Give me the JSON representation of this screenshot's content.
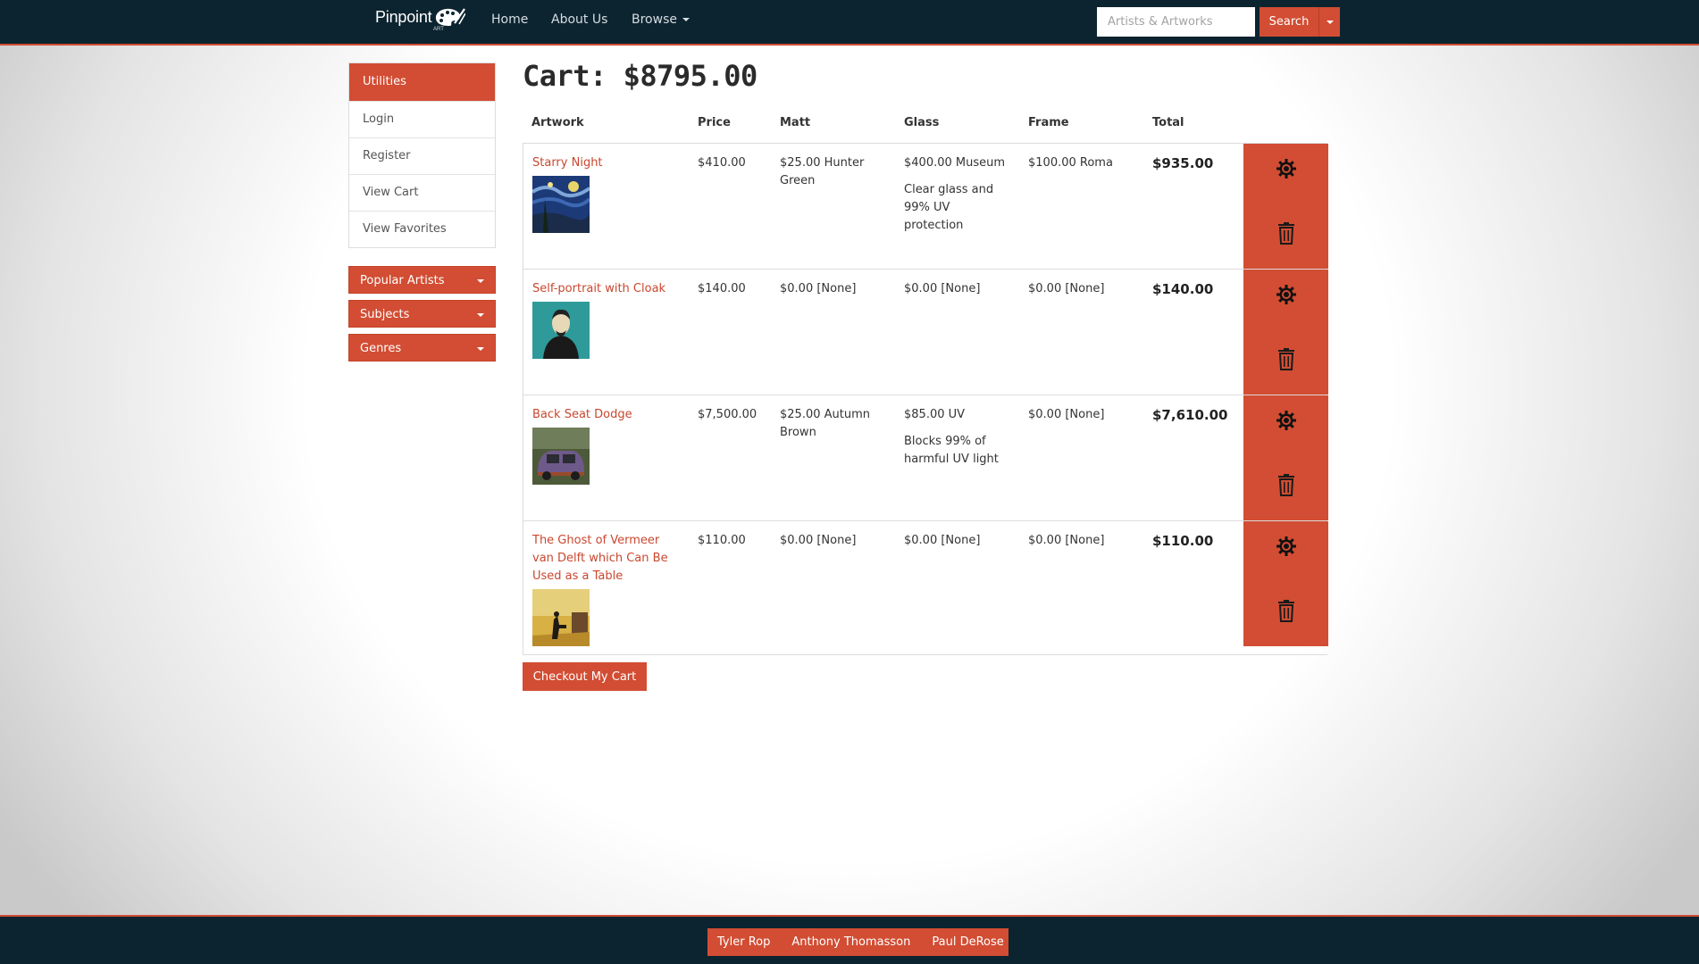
{
  "brand": {
    "name": "Pinpoint",
    "sub": "ART"
  },
  "nav": {
    "home": "Home",
    "about": "About Us",
    "browse": "Browse"
  },
  "search": {
    "placeholder": "Artists & Artworks",
    "button": "Search"
  },
  "sidebar": {
    "utilities_title": "Utilities",
    "items": [
      "Login",
      "Register",
      "View Cart",
      "View Favorites"
    ],
    "dropdowns": [
      "Popular Artists",
      "Subjects",
      "Genres"
    ]
  },
  "cart": {
    "title": "Cart: $8795.00",
    "headers": {
      "artwork": "Artwork",
      "price": "Price",
      "matt": "Matt",
      "glass": "Glass",
      "frame": "Frame",
      "total": "Total"
    },
    "rows": [
      {
        "title": "Starry Night",
        "price": "$410.00",
        "matt": "$25.00 Hunter Green",
        "glass": "$400.00 Museum",
        "glass_desc": "Clear glass and 99% UV protection",
        "frame": "$100.00 Roma",
        "total": "$935.00"
      },
      {
        "title": "Self-portrait with Cloak",
        "price": "$140.00",
        "matt": "$0.00 [None]",
        "glass": "$0.00 [None]",
        "glass_desc": "",
        "frame": "$0.00 [None]",
        "total": "$140.00"
      },
      {
        "title": "Back Seat Dodge",
        "price": "$7,500.00",
        "matt": "$25.00 Autumn Brown",
        "glass": "$85.00 UV",
        "glass_desc": "Blocks 99% of harmful UV light",
        "frame": "$0.00 [None]",
        "total": "$7,610.00"
      },
      {
        "title": "The Ghost of Vermeer van Delft which Can Be Used as a Table",
        "price": "$110.00",
        "matt": "$0.00 [None]",
        "glass": "$0.00 [None]",
        "glass_desc": "",
        "frame": "$0.00 [None]",
        "total": "$110.00"
      }
    ],
    "checkout": "Checkout My Cart"
  },
  "footer": {
    "credits": [
      "Tyler Rop",
      "Anthony Thomasson",
      "Paul DeRose"
    ]
  },
  "icons": {
    "settings": "gear-icon",
    "delete": "trash-icon",
    "logo": "palette-logo-icon"
  },
  "colors": {
    "accent": "#d24d33",
    "navbar": "#0c2430",
    "link": "#c9472f"
  }
}
